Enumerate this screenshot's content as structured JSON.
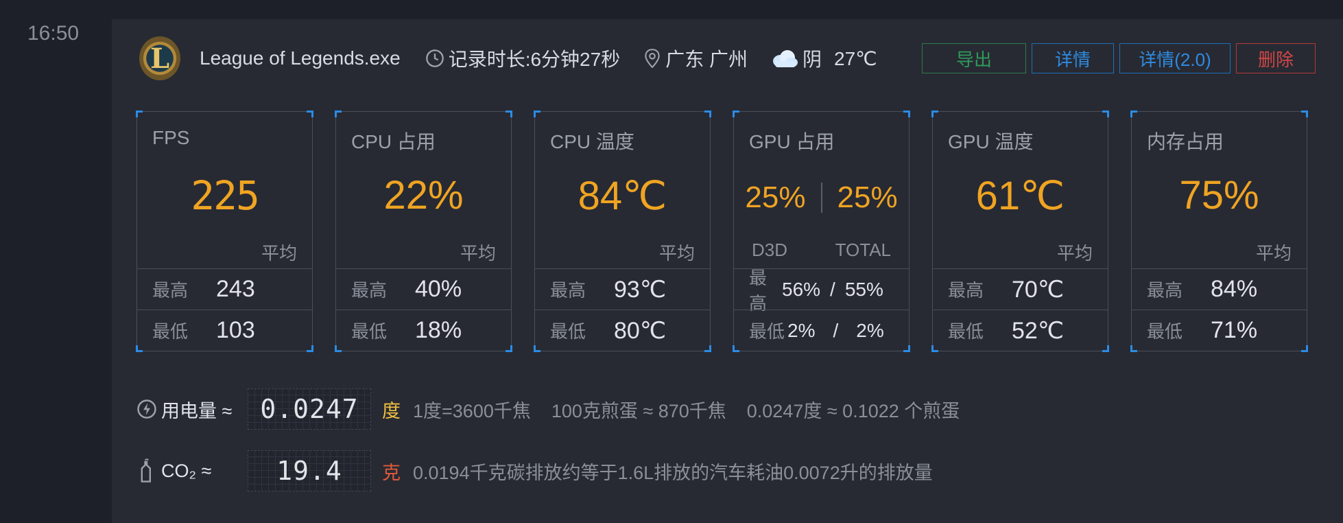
{
  "time": "16:50",
  "header": {
    "app_logo_letter": "L",
    "app_name": "League of Legends.exe",
    "duration": "记录时长:6分钟27秒",
    "location": "广东 广州",
    "weather": "阴",
    "temperature": "27℃"
  },
  "buttons": {
    "export": "导出",
    "detail": "详情",
    "detail2": "详情(2.0)",
    "delete": "删除"
  },
  "labels": {
    "avg": "平均",
    "max": "最高",
    "min": "最低",
    "d3d": "D3D",
    "total": "TOTAL"
  },
  "panels": {
    "fps": {
      "title": "FPS",
      "value": "225",
      "max": "243",
      "min": "103"
    },
    "cpu_usage": {
      "title": "CPU 占用",
      "value": "22%",
      "max": "40%",
      "min": "18%"
    },
    "cpu_temp": {
      "title": "CPU 温度",
      "value": "84℃",
      "max": "93℃",
      "min": "80℃"
    },
    "gpu_usage": {
      "title": "GPU 占用",
      "value_d3d": "25%",
      "value_total": "25%",
      "max_d3d": "56%",
      "max_total": "55%",
      "min_d3d": "2%",
      "min_total": "2%",
      "slash": "/"
    },
    "gpu_temp": {
      "title": "GPU 温度",
      "value": "61℃",
      "max": "70℃",
      "min": "52℃"
    },
    "memory": {
      "title": "内存占用",
      "value": "75%",
      "max": "84%",
      "min": "71%"
    }
  },
  "power": {
    "label": "用电量 ≈",
    "value": "0.0247",
    "unit": "度",
    "description": "1度=3600千焦    100克煎蛋 ≈ 870千焦    0.0247度 ≈ 0.1022 个煎蛋"
  },
  "co2": {
    "label": "CO₂ ≈",
    "value": "19.4",
    "unit": "克",
    "description": "0.0194千克碳排放约等于1.6L排放的汽车耗油0.0072升的排放量"
  },
  "colors": {
    "accent": "#f0a422",
    "button_blue": "#2f8be0",
    "button_green": "#2f9a5a",
    "button_red": "#d04646",
    "corner_blue": "#2a8ce6"
  }
}
